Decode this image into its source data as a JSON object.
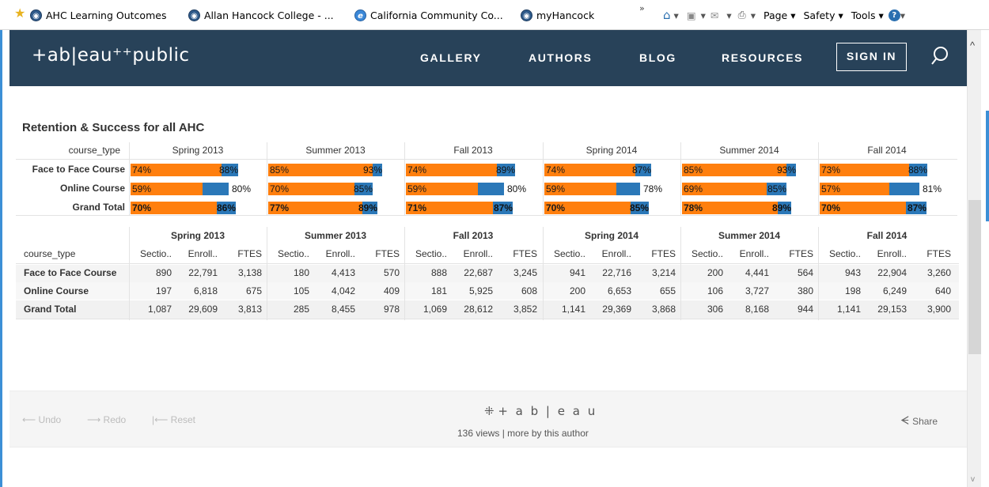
{
  "browser": {
    "favorites": [
      {
        "label": "AHC Learning Outcomes",
        "icon": "site-icon"
      },
      {
        "label": "Allan Hancock College - ...",
        "icon": "site-icon"
      },
      {
        "label": "California Community Co...",
        "icon": "ie-icon"
      },
      {
        "label": "myHancock",
        "icon": "site-icon"
      }
    ],
    "overflow": "»",
    "tools": {
      "page": "Page ▾",
      "safety": "Safety ▾",
      "tools": "Tools ▾"
    }
  },
  "header": {
    "logo": "+ab|eau⁺⁺public",
    "nav": [
      "GALLERY",
      "AUTHORS",
      "BLOG",
      "RESOURCES"
    ],
    "signin": "SIGN IN"
  },
  "viz": {
    "title": "Retention & Success for all AHC",
    "row_header": "course_type",
    "terms": [
      "Spring 2013",
      "Summer 2013",
      "Fall 2013",
      "Spring 2014",
      "Summer 2014",
      "Fall 2014"
    ],
    "rows": [
      "Face to Face Course",
      "Online Course",
      "Grand Total"
    ]
  },
  "chart_data": {
    "type": "bar",
    "title": "Retention & Success for all AHC",
    "categories": [
      "Spring 2013",
      "Summer 2013",
      "Fall 2013",
      "Spring 2014",
      "Summer 2014",
      "Fall 2014"
    ],
    "series": [
      {
        "name": "Face to Face Course",
        "success": [
          74,
          85,
          74,
          74,
          85,
          73
        ],
        "retention": [
          88,
          93,
          89,
          87,
          93,
          88
        ]
      },
      {
        "name": "Online Course",
        "success": [
          59,
          70,
          59,
          59,
          69,
          57
        ],
        "retention": [
          80,
          85,
          80,
          78,
          85,
          81
        ]
      },
      {
        "name": "Grand Total",
        "success": [
          70,
          77,
          71,
          70,
          78,
          70
        ],
        "retention": [
          86,
          89,
          87,
          85,
          89,
          87
        ]
      }
    ],
    "colors": {
      "success": "#ff7f0e",
      "retention": "#2b78b8"
    }
  },
  "table": {
    "row_header": "course_type",
    "sub_headers": [
      "Sectio..",
      "Enroll..",
      "FTES"
    ],
    "rows": [
      {
        "label": "Face to Face Course",
        "values": [
          [
            "890",
            "22,791",
            "3,138"
          ],
          [
            "180",
            "4,413",
            "570"
          ],
          [
            "888",
            "22,687",
            "3,245"
          ],
          [
            "941",
            "22,716",
            "3,214"
          ],
          [
            "200",
            "4,441",
            "564"
          ],
          [
            "943",
            "22,904",
            "3,260"
          ]
        ]
      },
      {
        "label": "Online Course",
        "values": [
          [
            "197",
            "6,818",
            "675"
          ],
          [
            "105",
            "4,042",
            "409"
          ],
          [
            "181",
            "5,925",
            "608"
          ],
          [
            "200",
            "6,653",
            "655"
          ],
          [
            "106",
            "3,727",
            "380"
          ],
          [
            "198",
            "6,249",
            "640"
          ]
        ]
      },
      {
        "label": "Grand Total",
        "values": [
          [
            "1,087",
            "29,609",
            "3,813"
          ],
          [
            "285",
            "8,455",
            "978"
          ],
          [
            "1,069",
            "28,612",
            "3,852"
          ],
          [
            "1,141",
            "29,369",
            "3,868"
          ],
          [
            "306",
            "8,168",
            "944"
          ],
          [
            "1,141",
            "29,153",
            "3,900"
          ]
        ]
      }
    ]
  },
  "footer": {
    "undo": "Undo",
    "redo": "Redo",
    "reset": "Reset",
    "brand": "+ a b | e a u",
    "views": "136 views | more by this author",
    "share": "Share"
  }
}
